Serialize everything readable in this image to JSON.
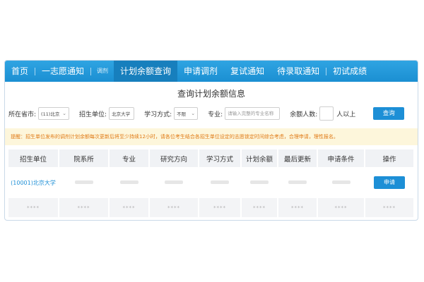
{
  "nav": {
    "items": [
      {
        "label": "首页",
        "small": false,
        "active": false,
        "sep_after": true
      },
      {
        "label": "一志愿通知",
        "small": false,
        "active": false,
        "sep_after": true
      },
      {
        "label": "调剂",
        "small": true,
        "active": false,
        "sep_after": false
      },
      {
        "label": "计划余额查询",
        "small": false,
        "active": true,
        "sep_after": false
      },
      {
        "label": "申请调剂",
        "small": false,
        "active": false,
        "sep_after": false
      },
      {
        "label": "复试通知",
        "small": false,
        "active": false,
        "sep_after": false
      },
      {
        "label": "待录取通知",
        "small": false,
        "active": false,
        "sep_after": true
      },
      {
        "label": "初试成绩",
        "small": false,
        "active": false,
        "sep_after": false
      }
    ]
  },
  "page": {
    "title": "查询计划余额信息"
  },
  "filters": {
    "province_label": "所在省市:",
    "province_value": "(11)北京",
    "unit_label": "招生单位:",
    "unit_value": "北京大学",
    "mode_label": "学习方式:",
    "mode_value": "不限",
    "major_label": "专业:",
    "major_placeholder": "请输入完整的专业名称",
    "remain_label": "余额人数:",
    "remain_value": "",
    "remain_suffix": "人以上",
    "search_label": "查询"
  },
  "notice": {
    "text": "提醒：招生单位发布的调剂计划余额每次更新后将至少持续12小时，请各位考生结合各招生单位设定的志愿锁定时间综合考虑，合理申请，理性报名。"
  },
  "table": {
    "headers": [
      "招生单位",
      "院系所",
      "专业",
      "研究方向",
      "学习方式",
      "计划余额",
      "最后更新",
      "申请条件",
      "操作"
    ],
    "row1_unit": "(10001)北京大学",
    "row1_action": "申请",
    "row2_cells": [
      "****",
      "****",
      "****",
      "****",
      "****",
      "****",
      "****",
      "****",
      "****"
    ]
  },
  "colors": {
    "nav_bg": "#1b8fd2",
    "accent": "#1d8fd6",
    "notice_text": "#e07b17",
    "notice_bg": "#fdf6db"
  }
}
